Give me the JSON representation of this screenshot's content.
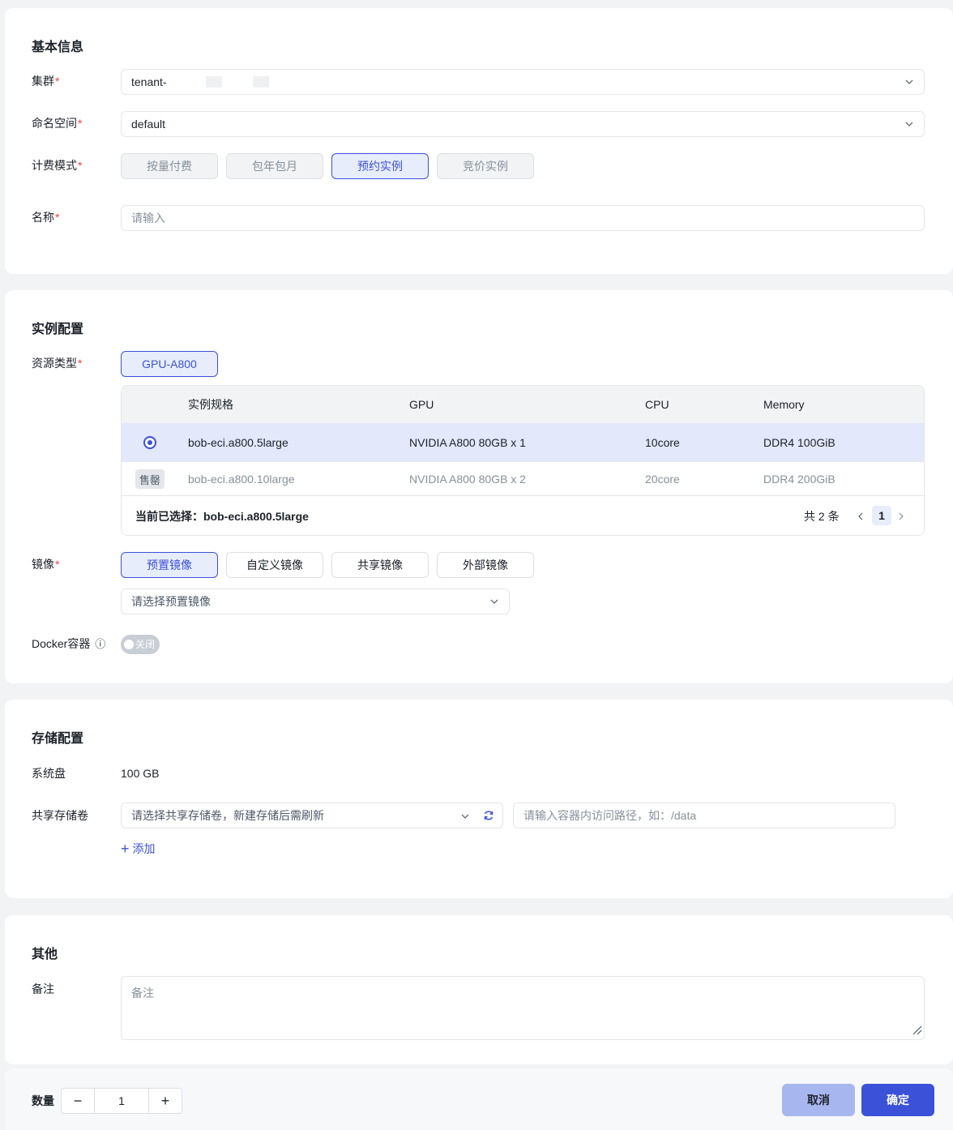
{
  "basic": {
    "title": "基本信息",
    "cluster_label": "集群",
    "cluster_value": "tenant-",
    "namespace_label": "命名空间",
    "namespace_value": "default",
    "billing_label": "计费模式",
    "billing_options": [
      "按量付费",
      "包年包月",
      "预约实例",
      "竞价实例"
    ],
    "billing_selected": "预约实例",
    "name_label": "名称",
    "name_placeholder": "请输入",
    "required_mark": "*"
  },
  "instance": {
    "title": "实例配置",
    "resource_label": "资源类型",
    "resource_value": "GPU-A800",
    "table": {
      "headers": [
        "实例规格",
        "GPU",
        "CPU",
        "Memory"
      ],
      "rows": [
        {
          "spec": "bob-eci.a800.5large",
          "gpu": "NVIDIA A800 80GB x 1",
          "cpu": "10core",
          "memory": "DDR4 100GiB",
          "selected": true
        },
        {
          "spec": "bob-eci.a800.10large",
          "gpu": "NVIDIA A800 80GB x 2",
          "cpu": "20core",
          "memory": "DDR4 200GiB",
          "badge": "售罄"
        }
      ],
      "current_selected": "当前已选择：bob-eci.a800.5large",
      "total": "共 2 条",
      "page": "1"
    },
    "image_label": "镜像",
    "image_tabs": [
      "预置镜像",
      "自定义镜像",
      "共享镜像",
      "外部镜像"
    ],
    "image_selected": "预置镜像",
    "image_placeholder": "请选择预置镜像",
    "docker_label": "Docker容器",
    "docker_info_icon": "ⓘ",
    "docker_toggle": "关闭"
  },
  "storage": {
    "title": "存储配置",
    "system_disk_label": "系统盘",
    "system_disk_value": "100 GB",
    "shared_label": "共享存储卷",
    "shared_placeholder": "请选择共享存储卷，新建存储后需刷新",
    "path_placeholder": "请输入容器内访问路径，如：/data",
    "add_label": "添加"
  },
  "other": {
    "title": "其他",
    "remark_label": "备注",
    "remark_placeholder": "备注"
  },
  "footer": {
    "quantity_label": "数量",
    "quantity_value": "1",
    "minus": "−",
    "plus": "+",
    "cancel": "取消",
    "confirm": "确定"
  },
  "colors": {
    "primary": "#3a51d8",
    "required": "#f53f3f",
    "selected_row": "#e3e8fb"
  }
}
